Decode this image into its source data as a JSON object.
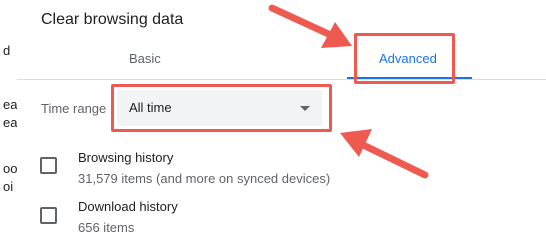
{
  "background_page": {
    "edge_fragments": [
      "d",
      "ea",
      "ea",
      "oo",
      "oi"
    ]
  },
  "dialog": {
    "title": "Clear browsing data",
    "tabs": [
      {
        "label": "Basic",
        "selected": false
      },
      {
        "label": "Advanced",
        "selected": true
      }
    ],
    "time_range": {
      "label": "Time range",
      "value": "All time"
    },
    "items": [
      {
        "title": "Browsing history",
        "subtitle": "31,579 items (and more on synced devices)",
        "checked": false
      },
      {
        "title": "Download history",
        "subtitle": "656 items",
        "checked": false
      }
    ]
  },
  "annotations": {
    "color": "#ef5a50"
  },
  "colors": {
    "accent": "#1a73e8",
    "text_primary": "#202124",
    "text_secondary": "#5f6368",
    "select_bg": "#f1f3f4"
  }
}
